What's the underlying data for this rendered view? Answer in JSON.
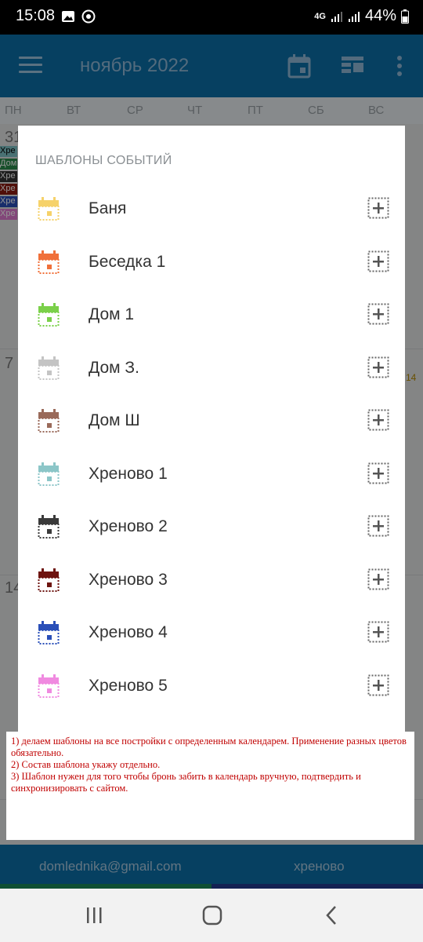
{
  "status_bar": {
    "time": "15:08",
    "network": "4G",
    "battery": "44%"
  },
  "app_bar": {
    "title": "ноябрь 2022"
  },
  "calendar": {
    "weekdays": [
      "ПН",
      "ВТ",
      "СР",
      "ЧТ",
      "ПТ",
      "СБ",
      "ВС"
    ],
    "visible_day_numbers": [
      "31",
      "7",
      "14"
    ],
    "side_label": "14",
    "event_snippets": [
      "Хре",
      "Дом",
      "Хре",
      "Хре",
      "Хре",
      "Хре"
    ]
  },
  "dialog": {
    "title": "ШАБЛОНЫ СОБЫТИЙ",
    "templates": [
      {
        "name": "Баня",
        "color": "#f6d26a"
      },
      {
        "name": "Беседка 1",
        "color": "#f0703a"
      },
      {
        "name": "Дом 1",
        "color": "#7bd04a"
      },
      {
        "name": "Дом З.",
        "color": "#c4c4c4"
      },
      {
        "name": "Дом Ш",
        "color": "#9a6a5a"
      },
      {
        "name": "Хреново 1",
        "color": "#8cc6c8"
      },
      {
        "name": "Хреново 2",
        "color": "#3a3a3a"
      },
      {
        "name": "Хреново 3",
        "color": "#6e1410"
      },
      {
        "name": "Хреново 4",
        "color": "#2a4fb8"
      },
      {
        "name": "Хреново 5",
        "color": "#f08ae0"
      }
    ]
  },
  "note": {
    "lines": [
      "1) делаем шаблоны на все постройки с определенным календарем. Применение разных цветов обязательно.",
      "2) Состав шаблона укажу отдельно.",
      "3) Шаблон нужен для того чтобы бронь забить в календарь вручную, подтвердить и синхронизировать с сайтом."
    ]
  },
  "bottom": {
    "account": "domlednika@gmail.com",
    "calendar_name": "хреново"
  },
  "colors": {
    "app_bar": "#0b6fa8",
    "note_text": "#c00000"
  }
}
